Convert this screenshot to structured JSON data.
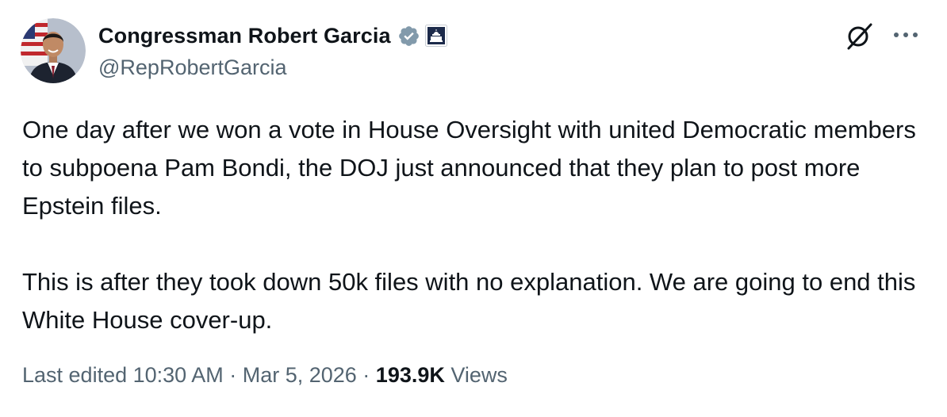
{
  "author": {
    "display_name": "Congressman Robert Garcia",
    "handle": "@RepRobertGarcia",
    "verified_icon": "verified-badge-gray",
    "affiliation_icon": "us-capitol-badge"
  },
  "actions": {
    "grok_icon": "grok-icon",
    "more_icon": "more-horizontal-icon"
  },
  "tweet": {
    "paragraphs": [
      "One day after we won a vote in House Oversight with united Democratic members to subpoena Pam Bondi, the DOJ just announced that they plan to post more Epstein files.",
      "This is after they took down 50k files with no explanation. We are going to end this White House cover-up."
    ]
  },
  "meta": {
    "edited_label": "Last edited",
    "time": "10:30 AM",
    "separator": " · ",
    "date": "Mar 5, 2026",
    "views_count": "193.9K",
    "views_label": "Views"
  },
  "colors": {
    "text": "#0f1419",
    "secondary": "#536471",
    "verified_gray": "#829aab"
  }
}
